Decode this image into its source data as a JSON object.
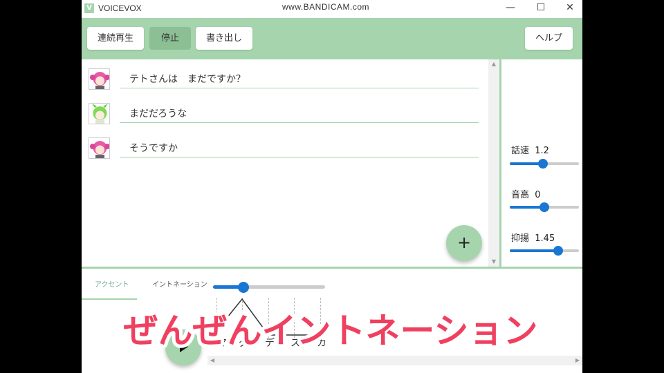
{
  "window": {
    "logo": "V",
    "title": "VOICEVOX",
    "watermark": "www.BANDICAM.com",
    "minimize": "—",
    "maximize": "☐",
    "close": "✕"
  },
  "toolbar": {
    "play_all_label": "連続再生",
    "stop_label": "停止",
    "export_label": "書き出し",
    "help_label": "ヘルプ"
  },
  "colors": {
    "accent": "#a5d4ad",
    "slider": "#1976d2",
    "caption_fill": "#f04060"
  },
  "lines": [
    {
      "text": "テトさんは　まだですか？",
      "character": "pink-haired-character"
    },
    {
      "text": "まだだろうな",
      "character": "green-haired-character"
    },
    {
      "text": "そうですか",
      "character": "pink-haired-character"
    }
  ],
  "params": {
    "speed": {
      "label": "話速",
      "value": "1.2",
      "level": 0.48
    },
    "pitch": {
      "label": "音高",
      "value": "0",
      "level": 0.5
    },
    "intonation": {
      "label": "抑揚",
      "value": "1.45",
      "level": 0.7
    }
  },
  "add_button": "+",
  "bottom": {
    "tab_accent": "アクセント",
    "tab_intonation": "イントネーション",
    "intonation_level": 0.27,
    "moras": [
      "マ",
      "ダ",
      "デ",
      "ス",
      "カ"
    ]
  },
  "caption": "ぜんぜんイントネーション"
}
